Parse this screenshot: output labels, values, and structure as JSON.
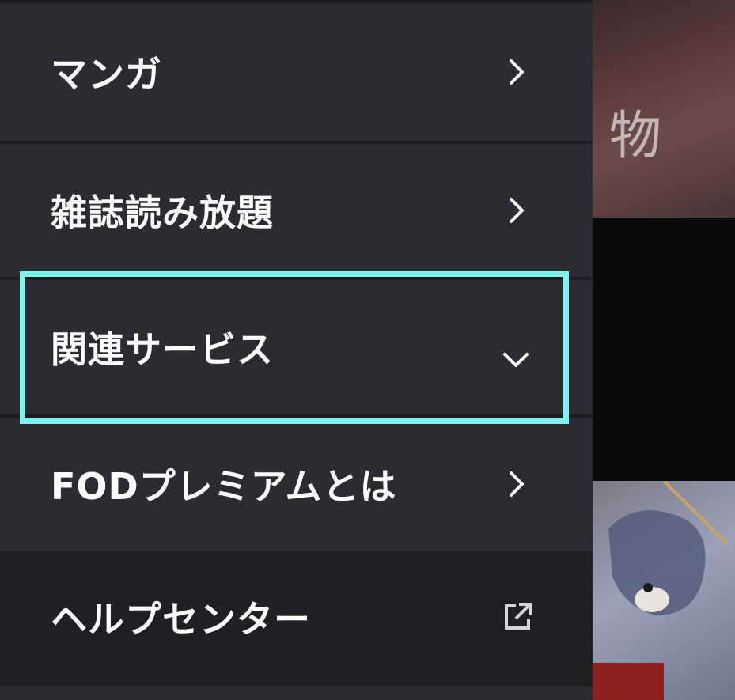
{
  "menu": {
    "items": [
      {
        "label": "マンガ",
        "icon": "chevron-right-icon"
      },
      {
        "label": "雑誌読み放題",
        "icon": "chevron-right-icon"
      },
      {
        "label": "関連サービス",
        "icon": "chevron-down-icon",
        "state": "focused"
      },
      {
        "label": "FODプレミアムとは",
        "icon": "chevron-right-icon"
      },
      {
        "label": "ヘルプセンター",
        "icon": "external-link-icon"
      }
    ]
  },
  "background": {
    "poster_text": "物"
  },
  "colors": {
    "menu_bg": "#2b2b31",
    "help_bg": "#1f1f24",
    "focus_ring": "#7df3ee",
    "text": "#ffffff"
  }
}
